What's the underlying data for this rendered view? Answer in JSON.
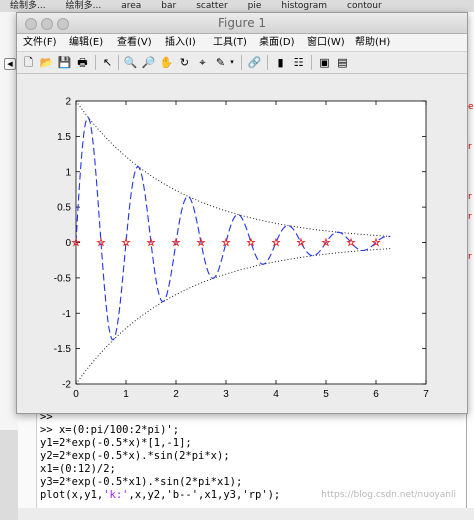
{
  "top_tabs": [
    "绘制多...",
    "绘制多...",
    "area",
    "bar",
    "scatter",
    "pie",
    "histogram",
    "contour"
  ],
  "window": {
    "title": "Figure 1"
  },
  "menu": [
    "文件(F)",
    "编辑(E)",
    "查看(V)",
    "插入(I)",
    "工具(T)",
    "桌面(D)",
    "窗口(W)",
    "帮助(H)"
  ],
  "toolbar_icons": [
    "new-figure-icon",
    "open-file-icon",
    "save-icon",
    "print-icon",
    "pointer-icon",
    "zoom-in-icon",
    "zoom-out-icon",
    "pan-icon",
    "rotate-icon",
    "data-cursor-icon",
    "brush-icon",
    "dropdown-icon",
    "link-icon",
    "colorbar-icon",
    "legend-icon",
    "hide-tools-icon",
    "dock-icon"
  ],
  "chart_data": {
    "type": "line",
    "xlim": [
      0,
      7
    ],
    "ylim": [
      -2,
      2
    ],
    "xticks": [
      "0",
      "1",
      "2",
      "3",
      "4",
      "5",
      "6",
      "7"
    ],
    "yticks": [
      "2",
      "1.5",
      "1",
      "0.5",
      "0",
      "-0.5",
      "-1",
      "-1.5",
      "-2"
    ],
    "grid": false,
    "series": [
      {
        "expr": "y1=2*exp(-0.5*x)*[1,-1]",
        "style": "k:",
        "color": "#000000",
        "x_range": [
          0,
          6.2832
        ]
      },
      {
        "expr": "y2=2*exp(-0.5*x).*sin(2*pi*x)",
        "style": "b--",
        "color": "#2233ee",
        "x_range": [
          0,
          6.2832
        ]
      },
      {
        "expr": "y3=2*exp(-0.5*x1).*sin(2*pi*x1)",
        "style": "rp",
        "color": "#ee2222",
        "x": [
          0,
          0.5,
          1,
          1.5,
          2,
          2.5,
          3,
          3.5,
          4,
          4.5,
          5,
          5.5,
          6
        ],
        "y": [
          0,
          0,
          0,
          0,
          0,
          0,
          0,
          0,
          0,
          0,
          0,
          0,
          0
        ]
      }
    ]
  },
  "command_window": {
    "lines": [
      {
        "code": ">>",
        "str": "",
        "tail": ""
      },
      {
        "code": ">> x=(0:pi/100:2*pi)';",
        "str": "",
        "tail": ""
      },
      {
        "code": "y1=2*exp(-0.5*x)*[1,-1];",
        "str": "",
        "tail": ""
      },
      {
        "code": "y2=2*exp(-0.5*x).*sin(2*pi*x);",
        "str": "",
        "tail": ""
      },
      {
        "code": "x1=(0:12)/2;",
        "str": "",
        "tail": ""
      },
      {
        "code": "y3=2*exp(-0.5*x1).*sin(2*pi*x1);",
        "str": "",
        "tail": ""
      },
      {
        "code": "plot(x,y1,",
        "str": "'k:'",
        "tail": ",x,y2,'b--',x1,y3,'rp');"
      }
    ],
    "watermark": "https://blog.csdn.net/nuoyanli"
  }
}
